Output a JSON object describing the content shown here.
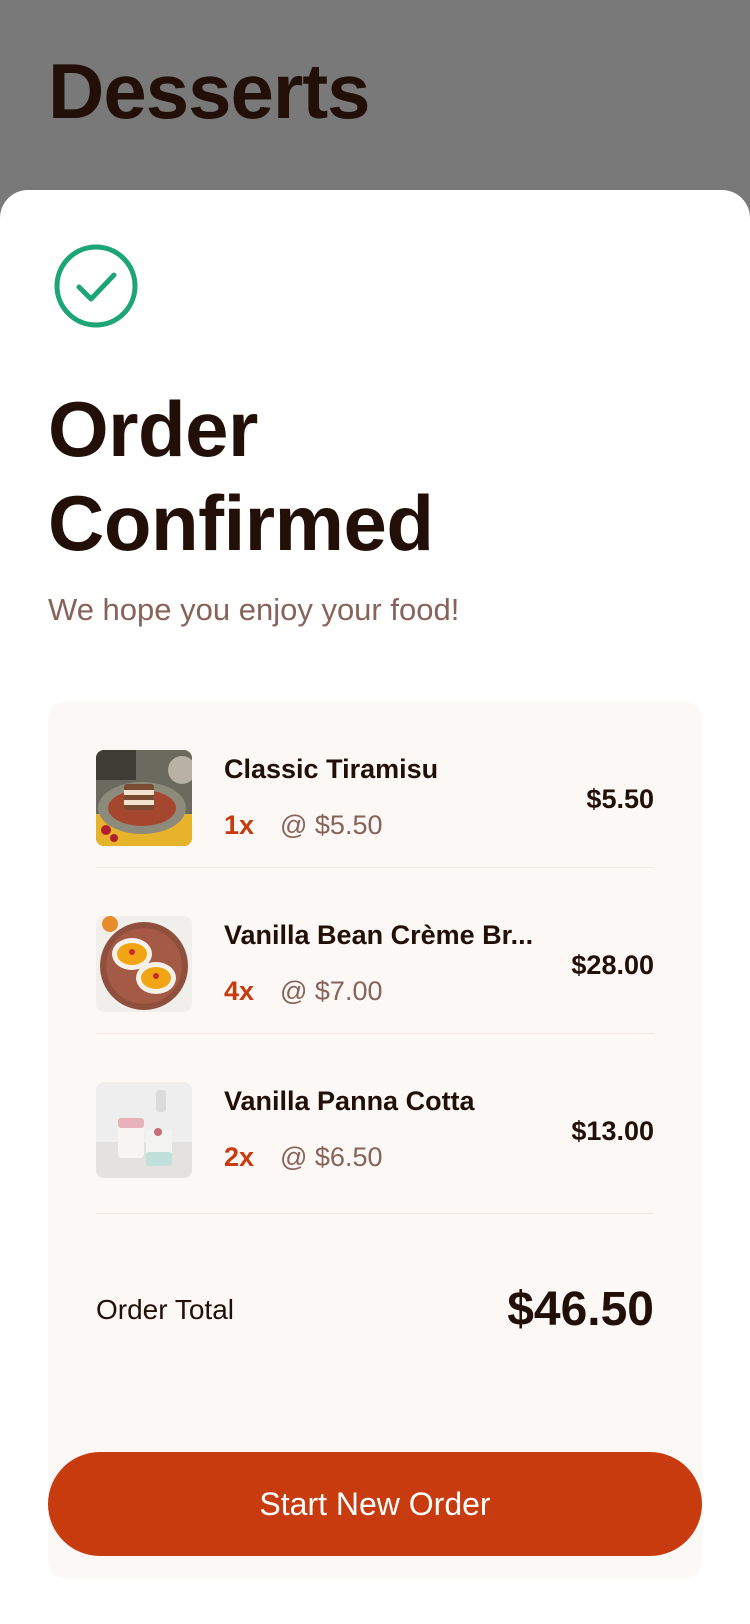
{
  "header": {
    "title": "Desserts"
  },
  "modal": {
    "icon": "check-circle-icon",
    "title_line1": "Order",
    "title_line2": "Confirmed",
    "subtitle": "We hope you enjoy your food!",
    "items": [
      {
        "name": "Classic Tiramisu",
        "quantity": "1x",
        "unit_price": "@ $5.50",
        "line_total": "$5.50",
        "image": "tiramisu-thumbnail"
      },
      {
        "name": "Vanilla Bean Crème Br...",
        "quantity": "4x",
        "unit_price": "@ $7.00",
        "line_total": "$28.00",
        "image": "creme-brulee-thumbnail"
      },
      {
        "name": "Vanilla Panna Cotta",
        "quantity": "2x",
        "unit_price": "@ $6.50",
        "line_total": "$13.00",
        "image": "panna-cotta-thumbnail"
      }
    ],
    "total_label": "Order Total",
    "total_value": "$46.50",
    "button_label": "Start New Order"
  },
  "colors": {
    "accent": "#c73b0f",
    "success": "#1ea575",
    "text_dark": "#220f07",
    "text_muted": "#87635a",
    "summary_bg": "#fcf8f6",
    "overlay": "#7a797a"
  }
}
